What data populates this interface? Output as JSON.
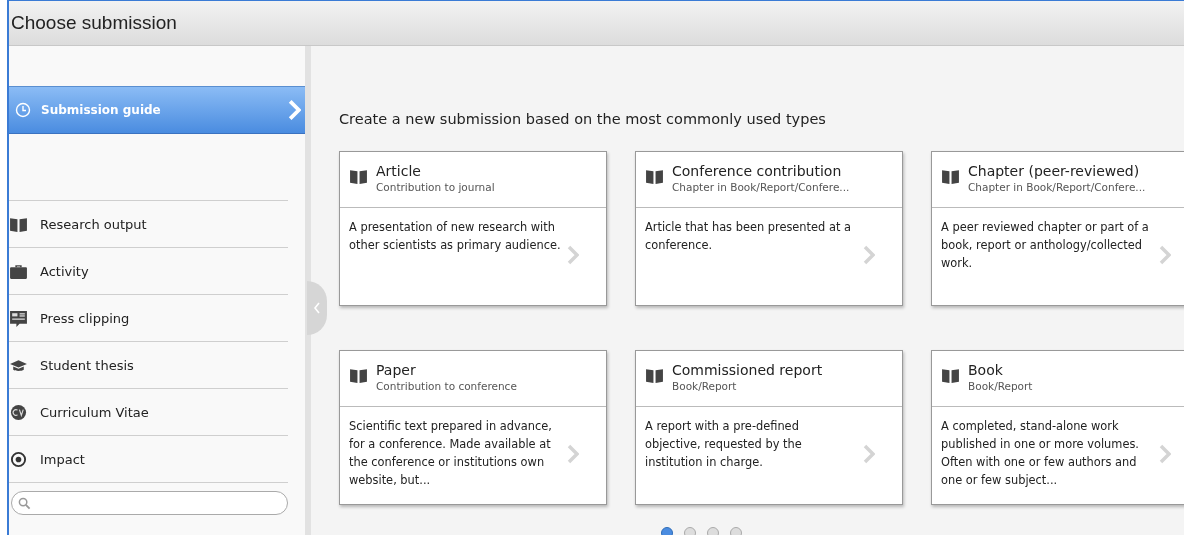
{
  "window": {
    "title": "Choose submission"
  },
  "sidebar": {
    "guide": {
      "label": "Submission guide",
      "selected": true
    },
    "items": [
      {
        "label": "Research output",
        "kind": "book"
      },
      {
        "label": "Activity",
        "kind": "briefcase"
      },
      {
        "label": "Press clipping",
        "kind": "clipping"
      },
      {
        "label": "Student thesis",
        "kind": "cap"
      },
      {
        "label": "Curriculum Vitae",
        "kind": "cv"
      },
      {
        "label": "Impact",
        "kind": "target"
      }
    ]
  },
  "main": {
    "heading": "Create a new submission based on the most commonly used types",
    "cards": [
      {
        "title": "Article",
        "subtitle": "Contribution to journal",
        "description": "A presentation of new research with other scientists as primary audience."
      },
      {
        "title": "Conference contribution",
        "subtitle": "Chapter in Book/Report/Confere...",
        "description": "Article that has been presented at a conference."
      },
      {
        "title": "Chapter (peer-reviewed)",
        "subtitle": "Chapter in Book/Report/Confere...",
        "description": "A peer reviewed chapter or part of a book, report or anthology/collected work."
      },
      {
        "title": "Paper",
        "subtitle": "Contribution to conference",
        "description": "Scientific text prepared in advance, for a conference. Made available at the conference or institutions own website, but..."
      },
      {
        "title": "Commissioned report",
        "subtitle": "Book/Report",
        "description": "A report with a pre-defined objective, requested by the institution in charge."
      },
      {
        "title": "Book",
        "subtitle": "Book/Report",
        "description": "A completed, stand-alone work published in one or more volumes. Often with one or few authors and one or few subject..."
      }
    ],
    "pager": [
      {
        "selected": true
      },
      {
        "selected": false
      },
      {
        "selected": false
      },
      {
        "selected": false
      }
    ]
  }
}
